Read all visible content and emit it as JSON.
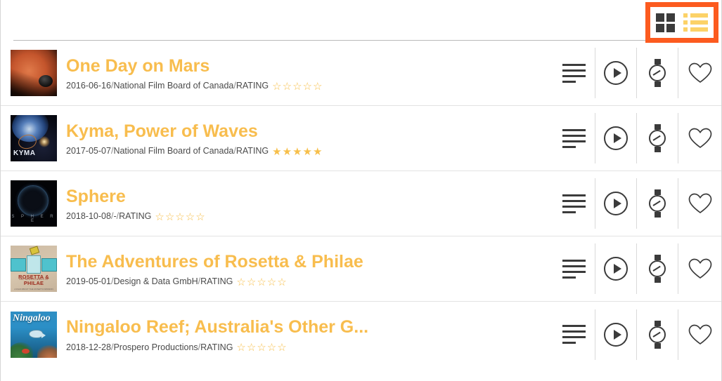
{
  "toolbar": {
    "grid_view_label": "grid-view",
    "list_view_label": "list-view",
    "active_view": "list"
  },
  "colors": {
    "accent_title": "#f8bd4e",
    "star": "#f7bf4a",
    "highlight_box": "#fc5b1f",
    "icon_dark": "#3b3b3b",
    "list_icon_yellow": "#fcd268"
  },
  "rating_label": "RATING",
  "separator": " / ",
  "actions": {
    "details_label": "details",
    "play_label": "play",
    "watch_later_label": "watch-later",
    "favorite_label": "favorite"
  },
  "items": [
    {
      "title": "One Day on Mars",
      "date": "2016-06-16",
      "producer": "National Film Board of Canada",
      "rating": 0,
      "max_rating": 5,
      "thumb": "mars"
    },
    {
      "title": "Kyma, Power of Waves",
      "date": "2017-05-07",
      "producer": "National Film Board of Canada",
      "rating": 5,
      "max_rating": 5,
      "thumb": "kyma",
      "thumb_label": "KYMA"
    },
    {
      "title": "Sphere",
      "date": "2018-10-08",
      "producer": "-",
      "rating": 0,
      "max_rating": 5,
      "thumb": "sphere",
      "thumb_label": "S P H E R E"
    },
    {
      "title": "The Adventures of Rosetta & Philae",
      "date": "2019-05-01",
      "producer": "Design & Data GmbH",
      "rating": 0,
      "max_rating": 5,
      "thumb": "rosetta",
      "thumb_label_small": "THE ADVENTURES OF",
      "thumb_label": "ROSETTA & PHILAE",
      "thumb_label_sub": "A FILM ABOUT THE ROSETTA MISSION"
    },
    {
      "title": "Ningaloo Reef; Australia's Other G...",
      "date": "2018-12-28",
      "producer": "Prospero Productions",
      "rating": 0,
      "max_rating": 5,
      "thumb": "ningaloo",
      "thumb_label": "Ningaloo"
    }
  ]
}
